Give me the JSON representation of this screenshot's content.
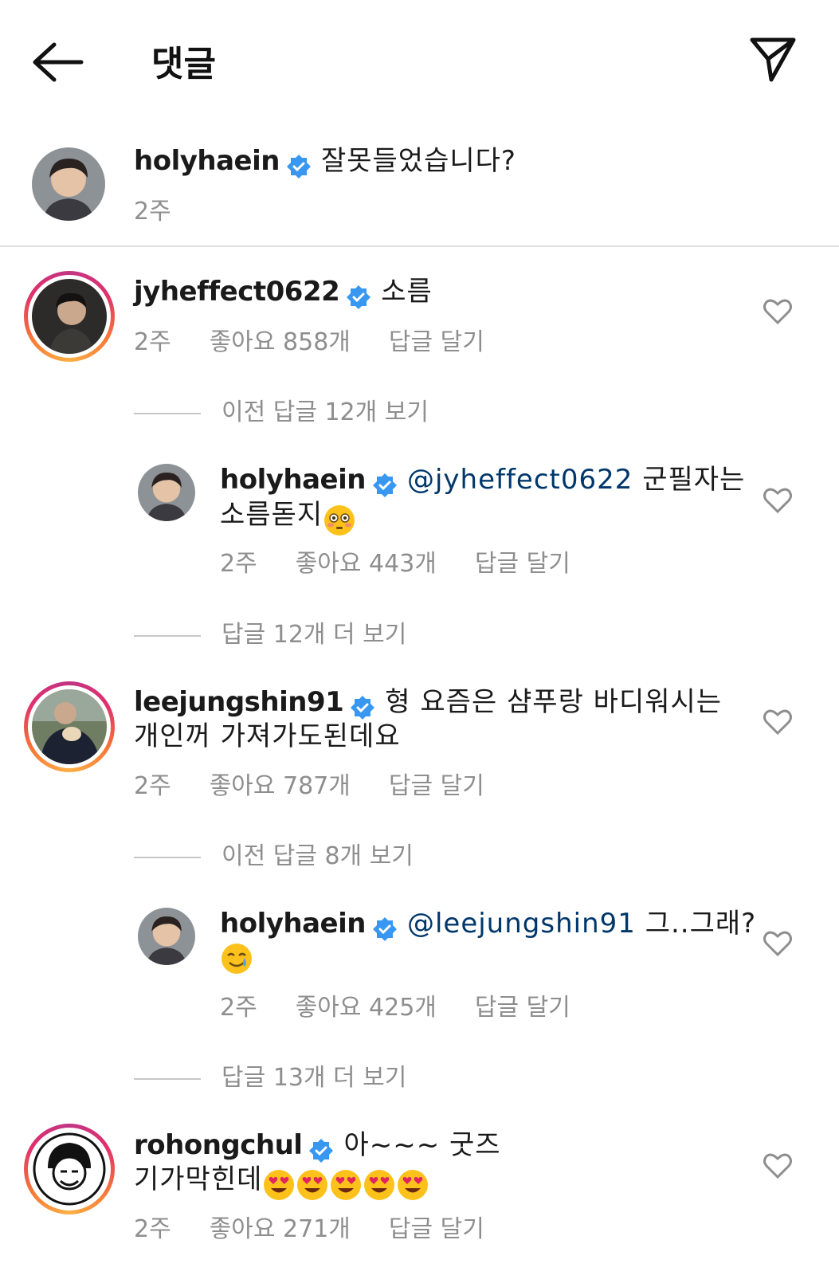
{
  "header": {
    "title": "댓글"
  },
  "caption": {
    "username": "holyhaein",
    "text": "잘못들었습니다?",
    "time": "2주"
  },
  "comments": [
    {
      "username": "jyheffect0622",
      "text": "소름",
      "time": "2주",
      "likes": "좋아요 858개",
      "reply": "답글 달기",
      "view_replies": "이전 답글 12개 보기",
      "reply_item": {
        "username": "holyhaein",
        "mention": "@jyheffect0622",
        "text_line1": "군필자는",
        "text_line2": "소름돋지",
        "emoji": "flushed-face",
        "time": "2주",
        "likes": "좋아요 443개",
        "reply": "답글 달기"
      },
      "more_replies": "답글 12개 더 보기"
    },
    {
      "username": "leejungshin91",
      "text_line1": "형 요즘은 샴푸랑 바디워시는",
      "text_line2": "개인꺼 가져가도된데요",
      "time": "2주",
      "likes": "좋아요 787개",
      "reply": "답글 달기",
      "view_replies": "이전 답글 8개 보기",
      "reply_item": {
        "username": "holyhaein",
        "mention": "@leejungshin91",
        "text_line1": "그..그래?",
        "emoji": "smiling-face-with-tear",
        "time": "2주",
        "likes": "좋아요 425개",
        "reply": "답글 달기"
      },
      "more_replies": "답글 13개 더 보기"
    },
    {
      "username": "rohongchul",
      "text_line1": "아~~~ 굿즈",
      "text_line2": "기가막힌데",
      "emoji": "heart-eyes-x5",
      "time": "2주",
      "likes": "좋아요 271개",
      "reply": "답글 달기"
    }
  ],
  "colors": {
    "verified": "#3897f0",
    "meta": "#8e8e8e",
    "mention": "#00376b"
  }
}
